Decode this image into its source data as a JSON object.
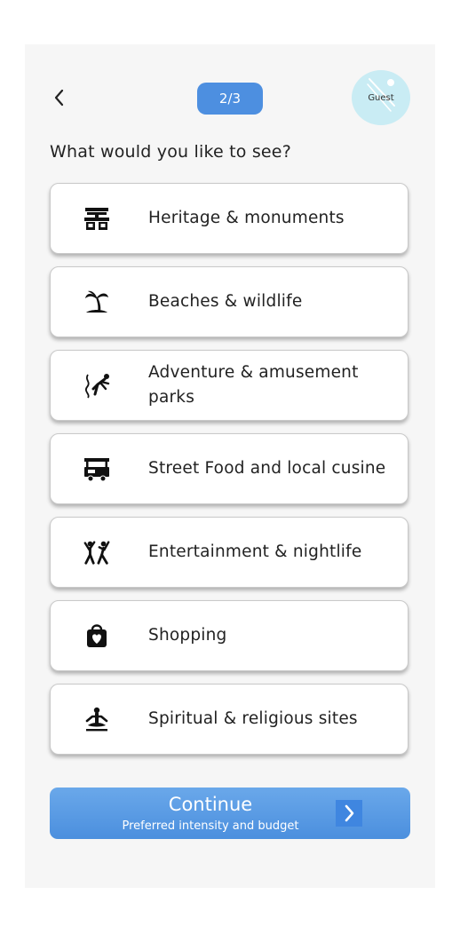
{
  "header": {
    "step": "2/3",
    "avatar_label": "Guest"
  },
  "question": "What would you like to see?",
  "options": [
    {
      "label": "Heritage & monuments",
      "icon": "monument-icon"
    },
    {
      "label": "Beaches & wildlife",
      "icon": "palm-tree-icon"
    },
    {
      "label": "Adventure & amusement parks",
      "icon": "bungee-jump-icon"
    },
    {
      "label": "Street Food and local cusine",
      "icon": "food-cart-icon"
    },
    {
      "label": "Entertainment & nightlife",
      "icon": "dancing-people-icon"
    },
    {
      "label": "Shopping",
      "icon": "shopping-bag-icon"
    },
    {
      "label": "Spiritual & religious sites",
      "icon": "meditation-icon"
    }
  ],
  "continue": {
    "title": "Continue",
    "subtitle": "Preferred intensity and budget"
  },
  "colors": {
    "accent": "#4d8fe0",
    "avatar_bg": "#c9ecf4",
    "background": "#f6f6f6"
  }
}
